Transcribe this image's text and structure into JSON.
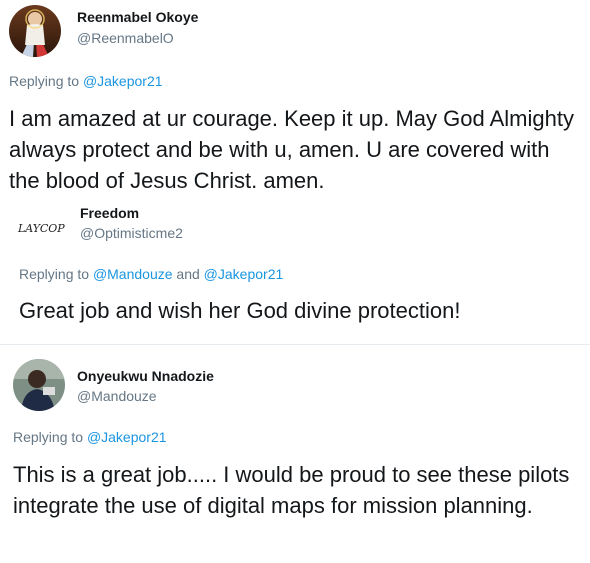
{
  "tweets": [
    {
      "name": "Reenmabel Okoye",
      "handle": "@ReenmabelO",
      "replying_prefix": "Replying to",
      "mentions": [
        "@Jakepor21"
      ],
      "text": "I am amazed at ur courage. Keep it up. May God Almighty always protect and be with u, amen. U are covered with the blood of Jesus Christ. amen.",
      "avatar_icon": "religious-portrait-avatar"
    },
    {
      "name": "Freedom",
      "handle": "@Optimisticme2",
      "replying_prefix": "Replying to",
      "mentions": [
        "@Mandouze",
        "@Jakepor21"
      ],
      "mention_joiner": "and",
      "text": "Great job and wish her God divine protection!",
      "avatar_logo_text": "LAYCOP",
      "avatar_icon": "laycop-logo-avatar"
    },
    {
      "name": "Onyeukwu Nnadozie",
      "handle": "@Mandouze",
      "replying_prefix": "Replying to",
      "mentions": [
        "@Jakepor21"
      ],
      "text": "This is a great job..... I would be proud to see these pilots integrate the use of digital maps for mission planning.",
      "avatar_icon": "person-photo-avatar"
    }
  ],
  "colors": {
    "text": "#14171a",
    "muted": "#657786",
    "link": "#1b95e0",
    "divider": "#e6ecf0"
  }
}
